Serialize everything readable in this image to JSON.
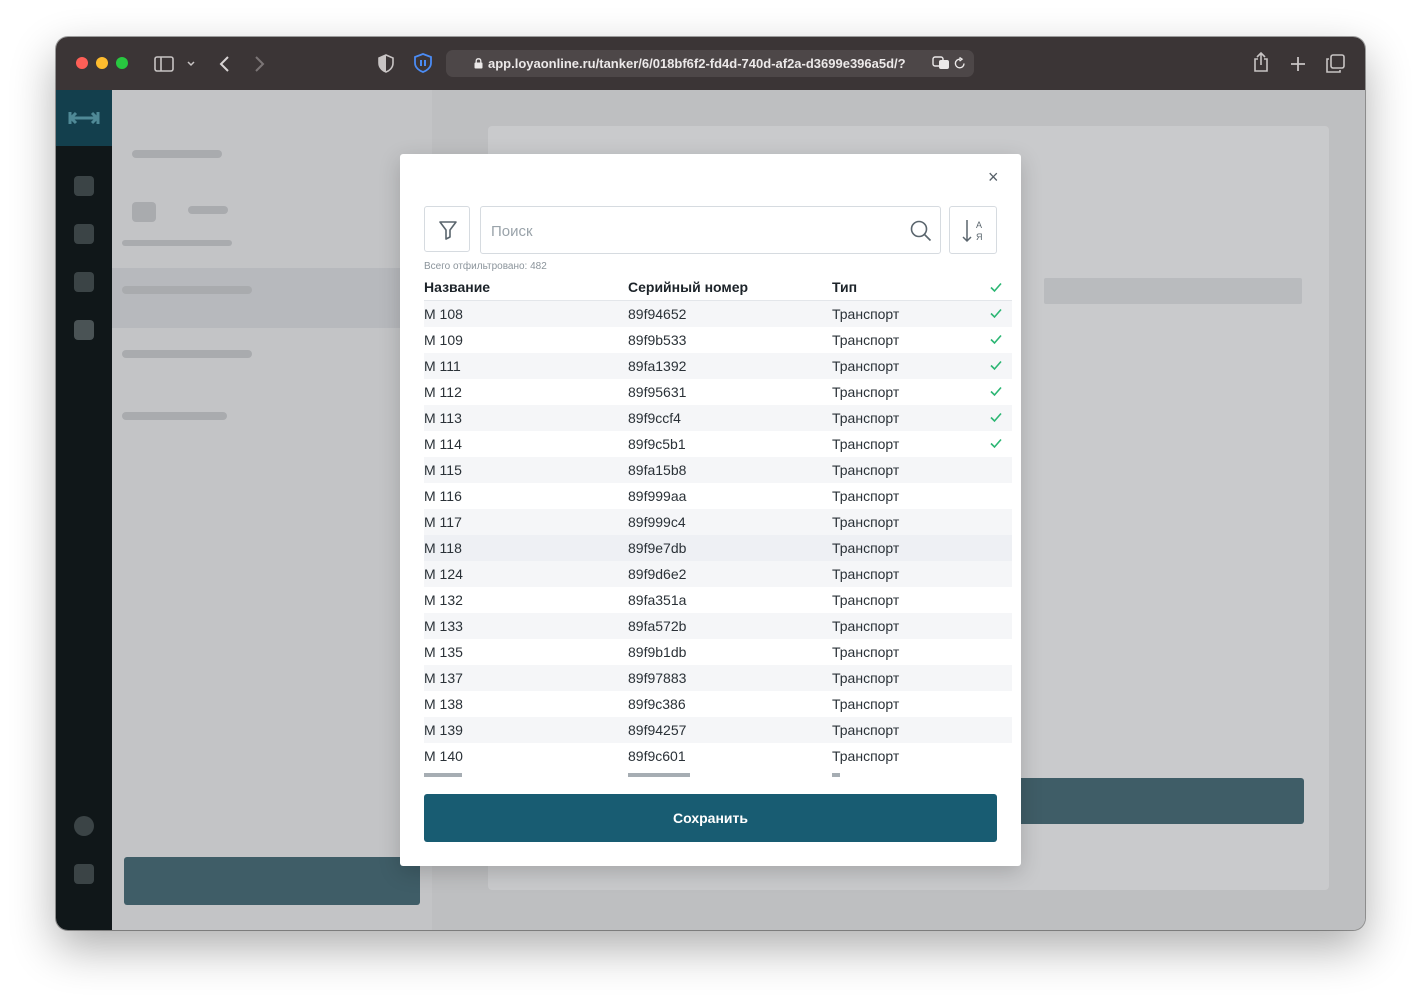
{
  "browser": {
    "url": "app.loyaonline.ru/tanker/6/018bf6f2-fd4d-740d-af2a-d3699e396a5d/?"
  },
  "modal": {
    "search_placeholder": "Поиск",
    "total_label": "Всего отфильтровано: 482",
    "columns": {
      "name": "Название",
      "serial": "Серийный номер",
      "type": "Тип"
    },
    "rows": [
      {
        "name": "М 108",
        "serial": "89f94652",
        "type": "Транспорт",
        "checked": true
      },
      {
        "name": "М 109",
        "serial": "89f9b533",
        "type": "Транспорт",
        "checked": true
      },
      {
        "name": "М 111",
        "serial": "89fa1392",
        "type": "Транспорт",
        "checked": true
      },
      {
        "name": "М 112",
        "serial": "89f95631",
        "type": "Транспорт",
        "checked": true
      },
      {
        "name": "М 113",
        "serial": "89f9ccf4",
        "type": "Транспорт",
        "checked": true
      },
      {
        "name": "М 114",
        "serial": "89f9c5b1",
        "type": "Транспорт",
        "checked": true
      },
      {
        "name": "М 115",
        "serial": "89fa15b8",
        "type": "Транспорт",
        "checked": false
      },
      {
        "name": "М 116",
        "serial": "89f999aa",
        "type": "Транспорт",
        "checked": false
      },
      {
        "name": "М 117",
        "serial": "89f999c4",
        "type": "Транспорт",
        "checked": false
      },
      {
        "name": "М 118",
        "serial": "89f9e7db",
        "type": "Транспорт",
        "checked": false
      },
      {
        "name": "М 124",
        "serial": "89f9d6e2",
        "type": "Транспорт",
        "checked": false
      },
      {
        "name": "М 132",
        "serial": "89fa351a",
        "type": "Транспорт",
        "checked": false
      },
      {
        "name": "М 133",
        "serial": "89fa572b",
        "type": "Транспорт",
        "checked": false
      },
      {
        "name": "М 135",
        "serial": "89f9b1db",
        "type": "Транспорт",
        "checked": false
      },
      {
        "name": "М 137",
        "serial": "89f97883",
        "type": "Транспорт",
        "checked": false
      },
      {
        "name": "М 138",
        "serial": "89f9c386",
        "type": "Транспорт",
        "checked": false
      },
      {
        "name": "М 139",
        "serial": "89f94257",
        "type": "Транспорт",
        "checked": false
      },
      {
        "name": "М 140",
        "serial": "89f9c601",
        "type": "Транспорт",
        "checked": false
      }
    ],
    "save_label": "Сохранить"
  },
  "colors": {
    "accent": "#185c72",
    "check": "#2bb673"
  }
}
